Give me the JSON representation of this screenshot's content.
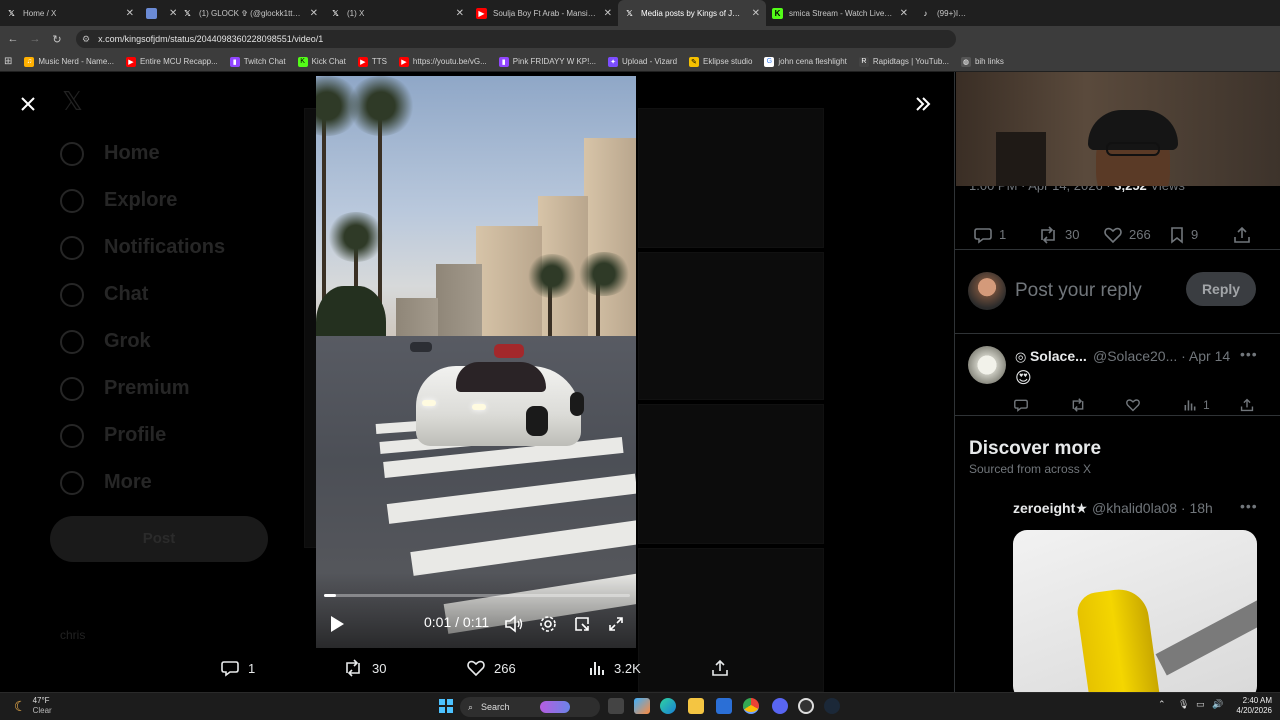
{
  "browser": {
    "tabs": [
      {
        "title": "Home / X",
        "favicon": "x-logo",
        "active": false
      },
      {
        "title": "",
        "favicon": "window-icon",
        "active": false
      },
      {
        "title": "(1) GLOCK ✞ (@glockk1tty) / X",
        "favicon": "x-logo",
        "active": false
      },
      {
        "title": "(1) X",
        "favicon": "x-logo",
        "active": false
      },
      {
        "title": "Soulja Boy Ft Arab - Mansion P",
        "favicon": "youtube-icon",
        "active": false
      },
      {
        "title": "Media posts by Kings of JDM (",
        "favicon": "x-logo",
        "active": true
      },
      {
        "title": "smica Stream - Watch Live on K",
        "favicon": "kick-icon",
        "active": false
      },
      {
        "title": "(99+)I need",
        "favicon": "tiktok-icon",
        "active": false
      }
    ],
    "url": "x.com/kingsofjdm/status/2044098360228098551/video/1",
    "bookmarks": [
      {
        "label": "Music Nerd - Name...",
        "icon": "music-icon",
        "color": "#ffb000"
      },
      {
        "label": "Entire MCU Recapp...",
        "icon": "youtube-icon",
        "color": "#ff0000"
      },
      {
        "label": "Twitch Chat",
        "icon": "twitch-icon",
        "color": "#9146ff"
      },
      {
        "label": "Kick Chat",
        "icon": "kick-icon",
        "color": "#53fc18"
      },
      {
        "label": "TTS",
        "icon": "youtube-icon",
        "color": "#ff0000"
      },
      {
        "label": "https://youtu.be/vG...",
        "icon": "youtube-icon",
        "color": "#ff0000"
      },
      {
        "label": "Pink FRIDAYY W KP!...",
        "icon": "twitch-icon",
        "color": "#9146ff"
      },
      {
        "label": "Upload - Vizard",
        "icon": "vizard-icon",
        "color": "#7c4dff"
      },
      {
        "label": "Eklipse studio",
        "icon": "eklipse-icon",
        "color": "#f5c000"
      },
      {
        "label": "john cena fleshlight",
        "icon": "google-icon",
        "color": "#4285f4"
      },
      {
        "label": "Rapidtags | YouTub...",
        "icon": "rapidtags-icon",
        "color": "#ffffff"
      },
      {
        "label": "bih links",
        "icon": "globe-icon",
        "color": "#9aa0a6"
      }
    ]
  },
  "background": {
    "nav_items": [
      "Home",
      "Explore",
      "Notifications",
      "Chat",
      "Grok",
      "Premium",
      "Profile",
      "More"
    ],
    "post_label": "Post",
    "user_name": "chris"
  },
  "video": {
    "current_time": "0:01",
    "duration": "0:11",
    "time_display": "0:01 / 0:11",
    "progress": 0.04
  },
  "actions": {
    "replies": "1",
    "reposts": "30",
    "likes": "266",
    "views": "3.2K"
  },
  "right_panel": {
    "meta": "1:00 PM · Apr 14, 2026 · ",
    "meta_views": "3,252",
    "meta_views_label": " Views",
    "stats": {
      "replies": "1",
      "reposts": "30",
      "likes": "266",
      "bookmarks": "9"
    },
    "reply_placeholder": "Post your reply",
    "reply_button": "Reply",
    "comment": {
      "name": "Solace...",
      "handle": "@Solace20... · Apr 14",
      "text": "😍",
      "views": "1"
    },
    "discover_title": "Discover more",
    "discover_sub": "Sourced from across X",
    "discover_post": {
      "name": "zeroeight★",
      "handle": "@khalid0la08 · 18h"
    }
  },
  "taskbar": {
    "temperature": "47°F",
    "condition": "Clear",
    "search": "Search",
    "time": "2:40 AM",
    "date": "4/20/2026"
  }
}
